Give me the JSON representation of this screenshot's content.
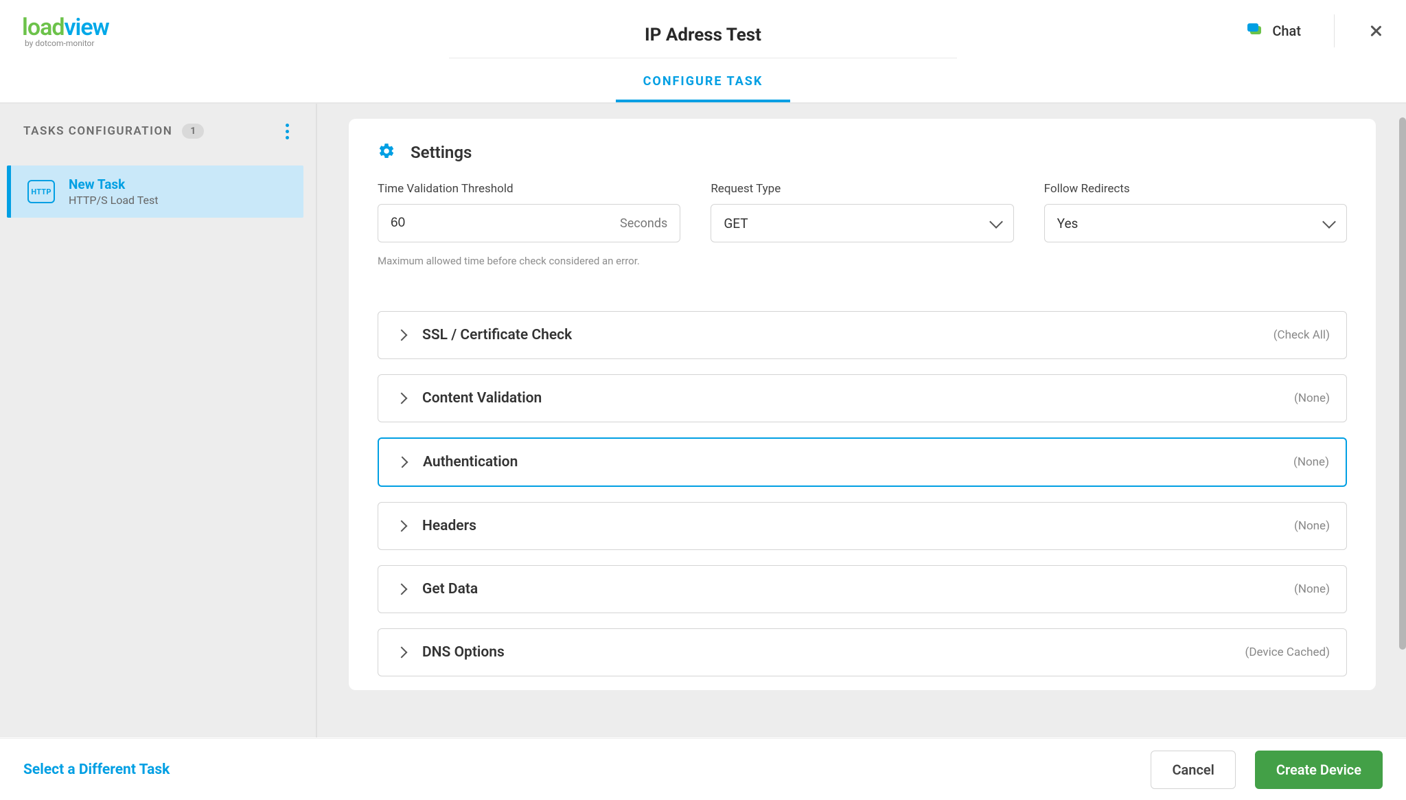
{
  "header": {
    "logo": {
      "green": "load",
      "blue": "view",
      "sub": "by dotcom-monitor"
    },
    "page_title": "IP Adress Test",
    "chat_label": "Chat",
    "tab_label": "CONFIGURE TASK"
  },
  "sidebar": {
    "title": "TASKS CONFIGURATION",
    "count": "1",
    "task": {
      "badge": "HTTP",
      "name": "New Task",
      "subtitle": "HTTP/S Load Test"
    }
  },
  "settings": {
    "section_title": "Settings",
    "time_threshold": {
      "label": "Time Validation Threshold",
      "value": "60",
      "unit": "Seconds",
      "help": "Maximum allowed time before check considered an error."
    },
    "request_type": {
      "label": "Request Type",
      "value": "GET"
    },
    "follow_redirects": {
      "label": "Follow Redirects",
      "value": "Yes"
    },
    "accordion": [
      {
        "title": "SSL / Certificate Check",
        "status": "(Check All)",
        "active": false
      },
      {
        "title": "Content Validation",
        "status": "(None)",
        "active": false
      },
      {
        "title": "Authentication",
        "status": "(None)",
        "active": true
      },
      {
        "title": "Headers",
        "status": "(None)",
        "active": false
      },
      {
        "title": "Get Data",
        "status": "(None)",
        "active": false
      },
      {
        "title": "DNS Options",
        "status": "(Device Cached)",
        "active": false
      }
    ]
  },
  "footer": {
    "link": "Select a Different Task",
    "cancel": "Cancel",
    "create": "Create Device"
  }
}
